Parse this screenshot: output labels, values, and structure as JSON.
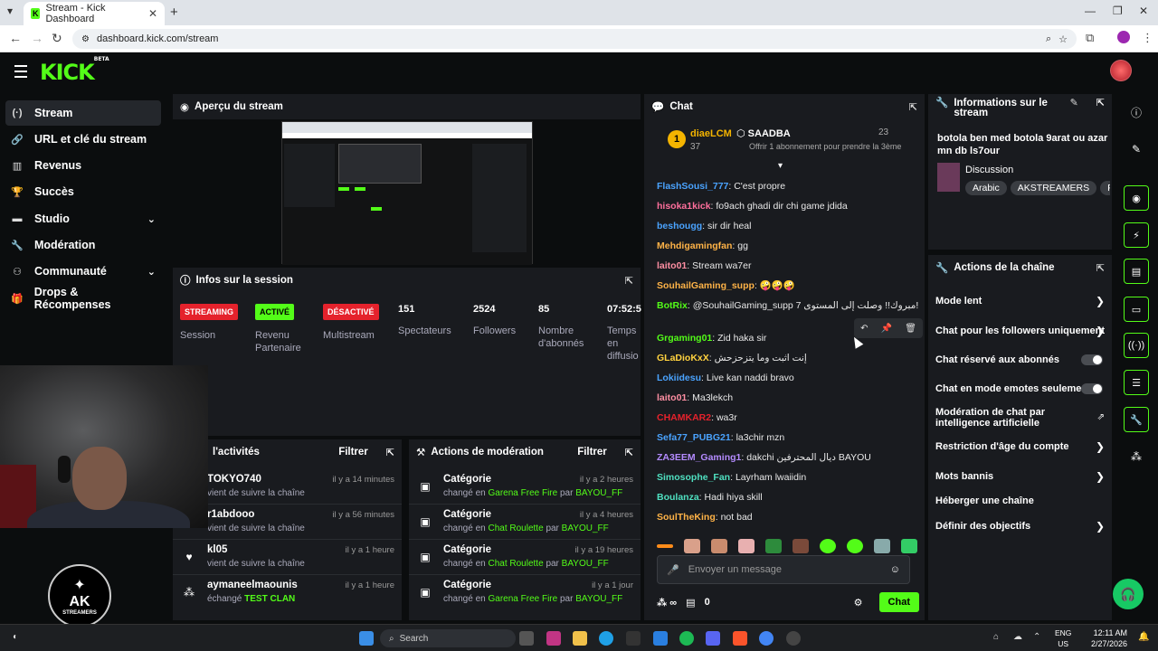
{
  "browser": {
    "tab_title": "Stream - Kick Dashboard",
    "url": "dashboard.kick.com/stream"
  },
  "header": {
    "logo": "KICK",
    "logo_sup": "BETA"
  },
  "sidebar": {
    "items": [
      {
        "label": "Stream",
        "icon": "stream-icon"
      },
      {
        "label": "URL et clé du stream",
        "icon": "link-icon"
      },
      {
        "label": "Revenus",
        "icon": "chart-icon"
      },
      {
        "label": "Succès",
        "icon": "trophy-icon"
      },
      {
        "label": "Studio",
        "icon": "studio-icon"
      },
      {
        "label": "Modération",
        "icon": "wrench-icon"
      },
      {
        "label": "Communauté",
        "icon": "community-icon"
      },
      {
        "label": "Drops & Récompenses",
        "icon": "gift-icon"
      }
    ]
  },
  "preview": {
    "title": "Aperçu du stream"
  },
  "session": {
    "title": "Infos sur la session",
    "badges": [
      {
        "text": "STREAMING",
        "label": "Session"
      },
      {
        "text": "ACTIVÉ",
        "label": "Revenu Partenaire"
      },
      {
        "text": "DÉSACTIVÉ",
        "label": "Multistream"
      }
    ],
    "stats": [
      {
        "value": "151",
        "label": "Spectateurs"
      },
      {
        "value": "2524",
        "label": "Followers"
      },
      {
        "value": "85",
        "label": "Nombre d'abonnés"
      },
      {
        "value": "07:52:5",
        "label": "Temps en diffusio"
      }
    ]
  },
  "activity": {
    "title": "l'activités",
    "filter": "Filtrer",
    "rows": [
      {
        "name": "TOKYO740",
        "sub": "vient de suivre la chaîne",
        "time": "il y a 14 minutes",
        "icon": "user-icon"
      },
      {
        "name": "r1abdooo",
        "sub": "vient de suivre la chaîne",
        "time": "il y a 56 minutes",
        "icon": "user-icon"
      },
      {
        "name": "kl05",
        "sub": "vient de suivre la chaîne",
        "time": "il y a 1 heure",
        "icon": "heart-icon"
      },
      {
        "name": "aymaneelmaounis",
        "sub": "échangé",
        "sub_hl": "TEST CLAN",
        "time": "il y a 1 heure",
        "icon": "points-icon"
      }
    ]
  },
  "moderation": {
    "title": "Actions de modération",
    "filter": "Filtrer",
    "rows": [
      {
        "name": "Catégorie",
        "pre": "changé en",
        "game": "Garena Free Fire",
        "by": "par",
        "user": "BAYOU_FF",
        "time": "il y a 2 heures"
      },
      {
        "name": "Catégorie",
        "pre": "changé en",
        "game": "Chat Roulette",
        "by": "par",
        "user": "BAYOU_FF",
        "time": "il y a 4 heures"
      },
      {
        "name": "Catégorie",
        "pre": "changé en",
        "game": "Chat Roulette",
        "by": "par",
        "user": "BAYOU_FF",
        "time": "il y a 19 heures"
      },
      {
        "name": "Catégorie",
        "pre": "changé en",
        "game": "Garena Free Fire",
        "by": "par",
        "user": "BAYOU_FF",
        "time": "il y a 1 jour"
      }
    ]
  },
  "chat": {
    "title": "Chat",
    "pinned": {
      "rank": "1",
      "user1": "diaeLCM",
      "count1": "37",
      "user2": "SAADBA",
      "count2": "23",
      "offer": "Offrir 1 abonnement pour prendre la 3ème"
    },
    "messages": [
      {
        "user": "FlashSousi_777",
        "color": "#4aa3ff",
        "text": "C'est propre"
      },
      {
        "user": "hisoka1kick",
        "color": "#ff6f9c",
        "text": "fo9ach ghadi dir chi game jdida"
      },
      {
        "user": "beshougg",
        "color": "#4aa3ff",
        "text": "sir dir heal"
      },
      {
        "user": "Mehdigamingfan",
        "color": "#ffb347",
        "text": "gg"
      },
      {
        "user": "laito01",
        "color": "#ff8fa3",
        "text": "Stream wa7er"
      },
      {
        "user": "SouhailGaming_supp",
        "color": "#ffb347",
        "text": "🤪🤪🤪"
      },
      {
        "user": "BotRix",
        "color": "#53fc18",
        "text": "@SouhailGaming_supp مبروك!! وصلت إلى المستوى 7!"
      },
      {
        "user": "Grgaming01",
        "color": "#53fc18",
        "text": "Zid haka sir"
      },
      {
        "user": "GLaDioKxX",
        "color": "#ffd23f",
        "text": "إنت اثبت وما يتزحزحش"
      },
      {
        "user": "Lokiidesu",
        "color": "#4aa3ff",
        "text": "Live kan naddi bravo"
      },
      {
        "user": "laito01",
        "color": "#ff8fa3",
        "text": "Ma3lekch"
      },
      {
        "user": "CHAMKAR2",
        "color": "#e5222c",
        "text": "wa3r"
      },
      {
        "user": "Sefa77_PUBG21",
        "color": "#4aa3ff",
        "text": "la3chir mzn"
      },
      {
        "user": "ZA3EEM_Gaming1",
        "color": "#b48bff",
        "text": "dakchi ديال المحترفين BAYOU"
      },
      {
        "user": "Simosophe_Fan",
        "color": "#4fe0c0",
        "text": "Layrham lwaiidin"
      },
      {
        "user": "Boulanza",
        "color": "#4fe0c0",
        "text": "Hadi hiya skill"
      },
      {
        "user": "SoulTheKing",
        "color": "#ffb347",
        "text": "not bad"
      }
    ],
    "input_placeholder": "Envoyer un message",
    "points": "0",
    "send": "Chat"
  },
  "stream_info": {
    "title": "Informations sur le stream",
    "stream_title": "botola ben med botola 9arat ou azar mn db ls7our",
    "category": "Discussion",
    "tags": [
      "Arabic",
      "AKSTREAMERS",
      "F"
    ]
  },
  "channel_actions": {
    "title": "Actions de la chaîne",
    "rows": [
      {
        "label": "Mode lent",
        "kind": "chevron"
      },
      {
        "label": "Chat pour les followers uniquement",
        "kind": "chevron"
      },
      {
        "label": "Chat réservé aux abonnés",
        "kind": "toggle"
      },
      {
        "label": "Chat en mode emotes seulement",
        "kind": "toggle"
      },
      {
        "label": "Modération de chat par intelligence artificielle",
        "kind": "external"
      },
      {
        "label": "Restriction d'âge du compte",
        "kind": "chevron"
      },
      {
        "label": "Mots bannis",
        "kind": "chevron"
      },
      {
        "label": "Héberger une chaîne",
        "kind": "none"
      },
      {
        "label": "Définir des objectifs",
        "kind": "chevron"
      }
    ]
  },
  "taskbar": {
    "search": "Search",
    "lang": "ENG",
    "region": "US",
    "time": "12:11 AM",
    "date": "2/27/2026"
  },
  "colors": {
    "accent": "#53fc18",
    "danger": "#e5222c",
    "panel": "#191b1f"
  }
}
